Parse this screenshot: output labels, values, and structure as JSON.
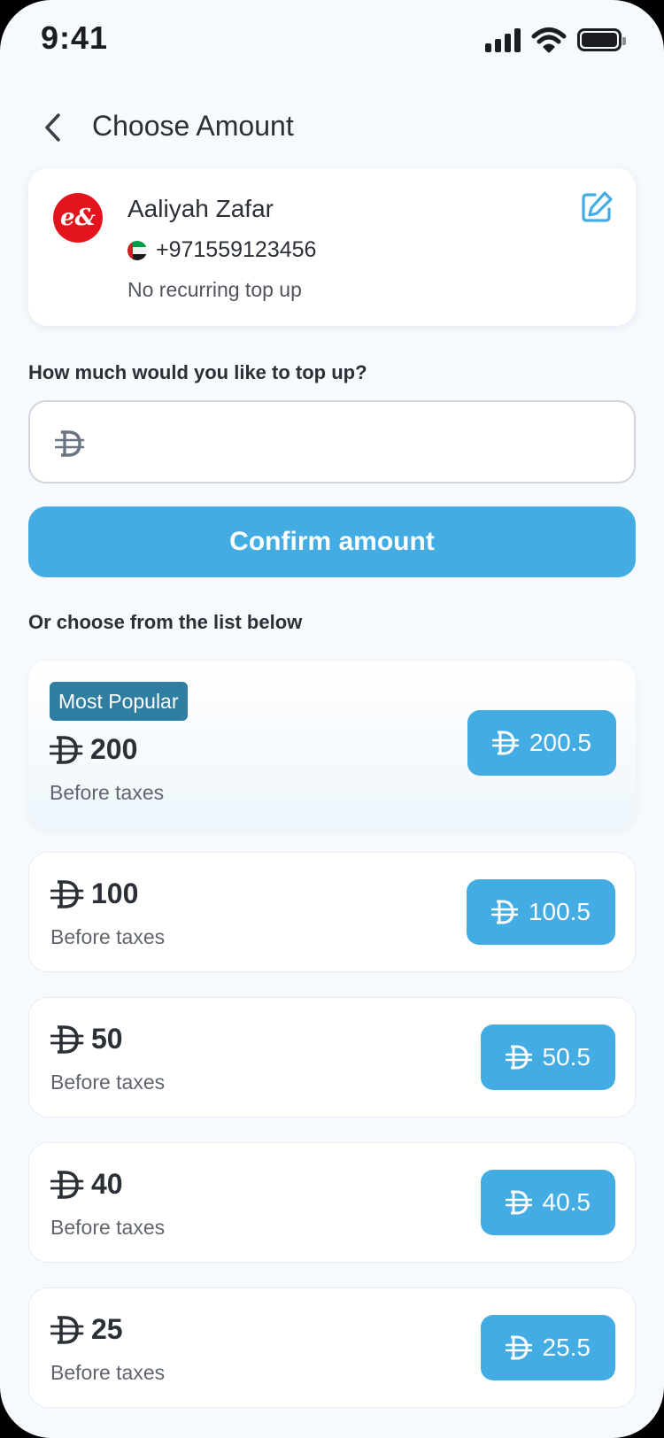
{
  "status_bar": {
    "time": "9:41"
  },
  "header": {
    "title": "Choose Amount"
  },
  "contact": {
    "name": "Aaliyah Zafar",
    "phone": "+971559123456",
    "recurring": "No recurring top up"
  },
  "topup": {
    "question": "How much would you like to top up?",
    "input_value": "",
    "confirm_label": "Confirm amount"
  },
  "list_label": "Or choose from the list below",
  "plans": [
    {
      "badge": "Most Popular",
      "amount": "200",
      "subtitle": "Before taxes",
      "price": "200.5"
    },
    {
      "amount": "100",
      "subtitle": "Before taxes",
      "price": "100.5"
    },
    {
      "amount": "50",
      "subtitle": "Before taxes",
      "price": "50.5"
    },
    {
      "amount": "40",
      "subtitle": "Before taxes",
      "price": "40.5"
    },
    {
      "amount": "25",
      "subtitle": "Before taxes",
      "price": "25.5"
    }
  ],
  "colors": {
    "accent": "#42ace3",
    "badge": "#2f7ea1",
    "operator": "#e3141e",
    "text": "#2b2f36"
  },
  "icons": {
    "back": "chevron-left-icon",
    "edit": "edit-icon",
    "currency": "dirham-icon"
  }
}
